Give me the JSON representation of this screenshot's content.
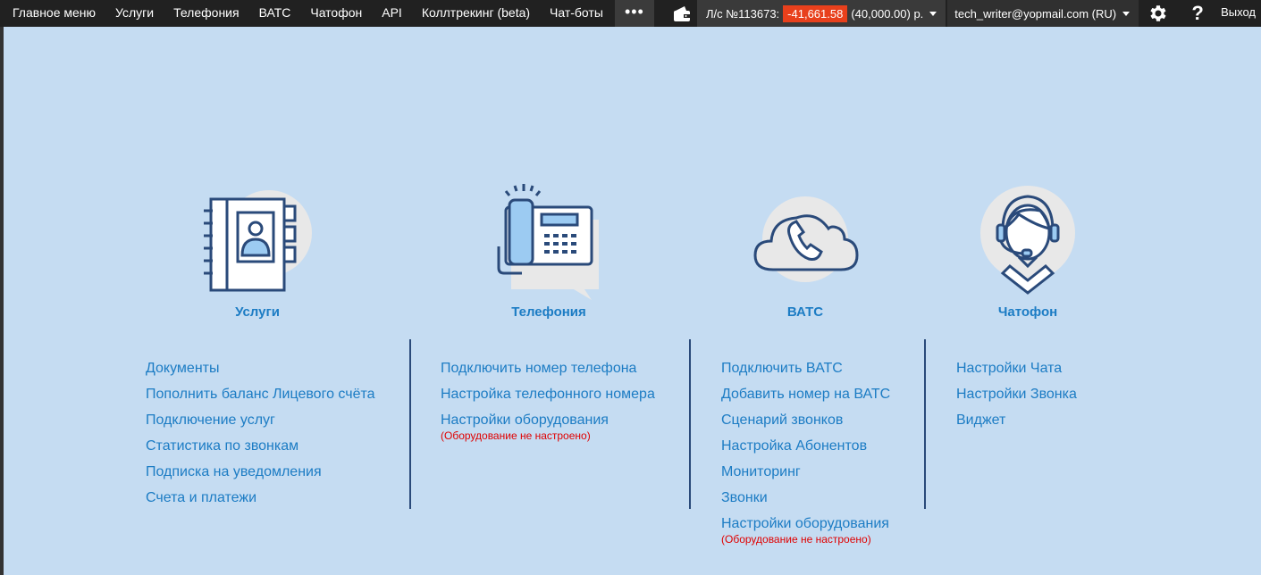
{
  "topnav": {
    "items": [
      "Главное меню",
      "Услуги",
      "Телефония",
      "ВАТС",
      "Чатофон",
      "API",
      "Коллтрекинг (beta)",
      "Чат-боты"
    ],
    "more": "•••"
  },
  "account": {
    "label": "Л/с №113673:",
    "balance": "-41,661.58",
    "credit": "(40,000.00) р."
  },
  "user": {
    "email": "tech_writer@yopmail.com (RU)"
  },
  "logout": "Выход",
  "help": "?",
  "cards": [
    {
      "title": "Услуги",
      "icon": "contacts-book-icon"
    },
    {
      "title": "Телефония",
      "icon": "desk-phone-icon"
    },
    {
      "title": "ВАТС",
      "icon": "cloud-phone-icon"
    },
    {
      "title": "Чатофон",
      "icon": "operator-headset-icon"
    }
  ],
  "columns": {
    "services": [
      "Документы",
      "Пополнить баланс Лицевого счёта",
      "Подключение услуг",
      "Статистика по звонкам",
      "Подписка на уведомления",
      "Счета и платежи"
    ],
    "telephony": [
      "Подключить номер телефона",
      "Настройка телефонного номера",
      "Настройки оборудования"
    ],
    "telephony_warning": "(Оборудование не настроено)",
    "vats": [
      "Подключить ВАТС",
      "Добавить номер на ВАТС",
      "Сценарий звонков",
      "Настройка Абонентов",
      "Мониторинг",
      "Звонки",
      "Настройки оборудования"
    ],
    "vats_warning": "(Оборудование не настроено)",
    "chatofon": [
      "Настройки Чата",
      "Настройки Звонка",
      "Виджет"
    ]
  },
  "colors": {
    "topbar": "#212121",
    "background": "#c5dcf2",
    "link": "#1c7cc4",
    "negative_balance": "#e8401c",
    "warning": "#e00000",
    "icon_stroke": "#2a4a7a",
    "icon_fill": "#9ccbf2"
  }
}
